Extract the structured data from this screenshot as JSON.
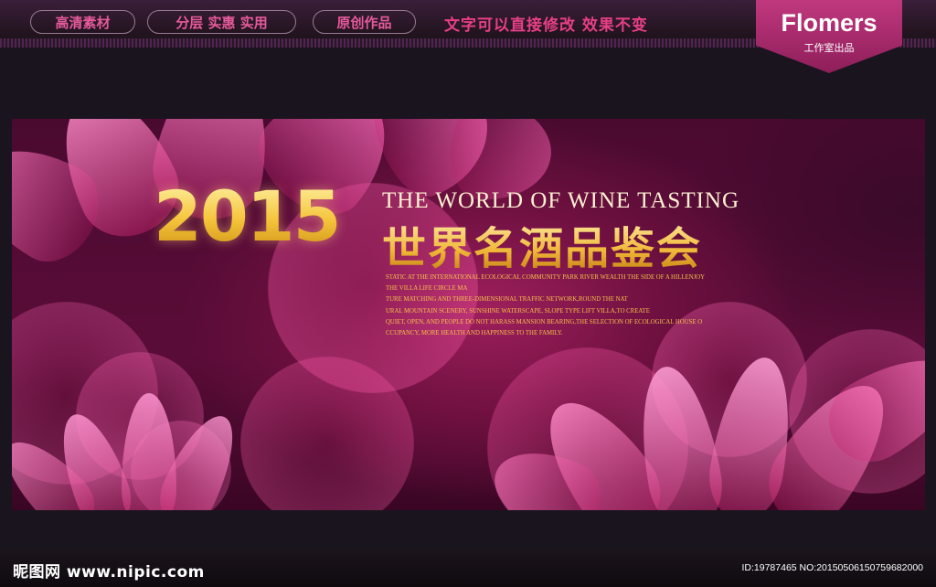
{
  "header": {
    "pills": [
      "高清素材",
      "分层 实惠 实用",
      "原创作品"
    ],
    "slogan": "文字可以直接修改  效果不变",
    "logo": {
      "name": "Flomers",
      "sub": "工作室出品"
    }
  },
  "banner": {
    "year": "2015",
    "en_title": "THE WORLD OF WINE TASTING",
    "cn_title": "世界名酒品鉴会",
    "paragraph_lines": [
      "STATIC AT THE INTERNATIONAL ECOLOGICAL COMMUNITY PARK RIVER WEALTH THE SIDE OF A HILLENJOY",
      "THE VILLA LIFE CIRCLE MA",
      "TURE MATCHING AND THREE-DIMENSIONAL TRAFFIC NETWORK,ROUND THE NAT",
      "URAL MOUNTAIN SCENERY, SUNSHINE WATERSCAPE, SLOPE TYPE LIFT VILLA,TO CREATE",
      "QUIET, OPEN, AND PEOPLE DO NOT HARASS MANSION BEARING,THE SELECTION OF ECOLOGICAL HOUSE O",
      "CCUPANCY, MORE HEALTH AND HAPPINESS TO THE FAMILY."
    ]
  },
  "footer": {
    "watermark": "昵图网 www.nipic.com",
    "id_info": "ID:19787465 NO:20150506150759682000"
  },
  "colors": {
    "accent": "#e83f86",
    "gold": "#f5c43a",
    "banner_bg": "#6e1040"
  }
}
